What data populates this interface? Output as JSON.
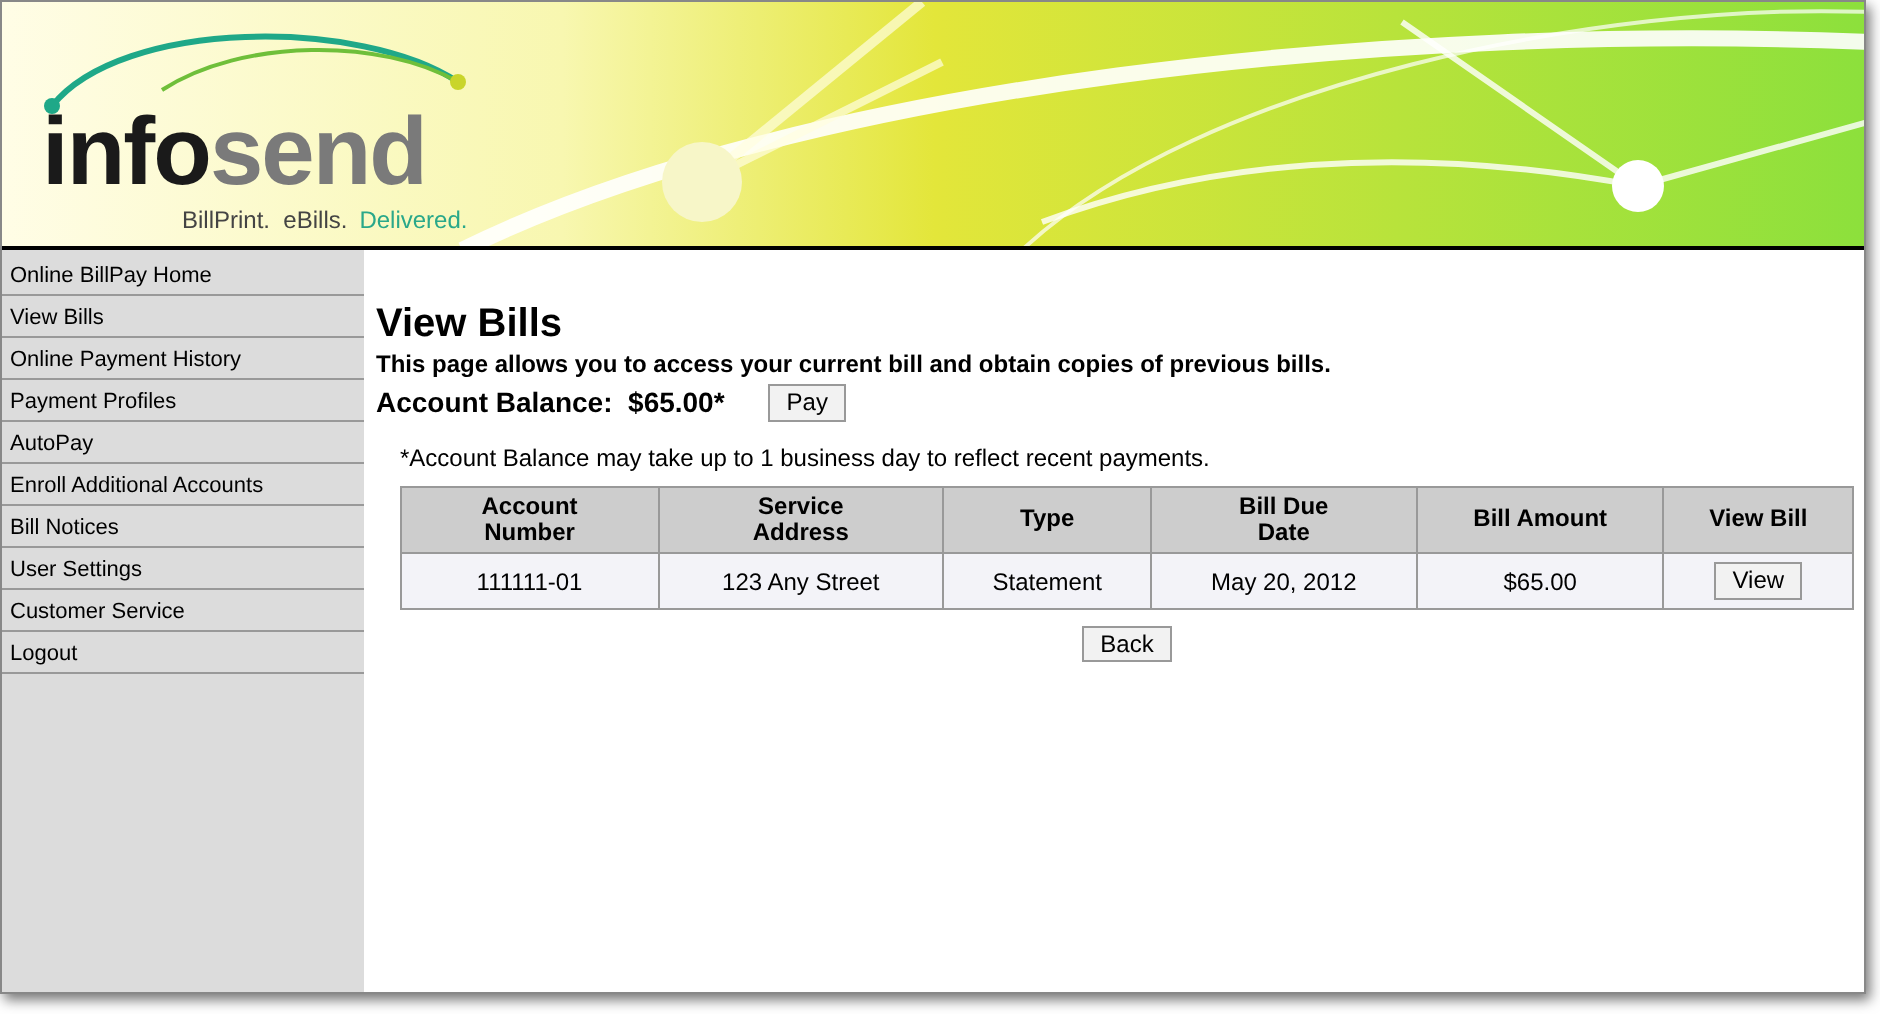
{
  "header": {
    "logo_parts": [
      "info",
      "send"
    ],
    "tagline": "BillPrint.  eBills.",
    "tagline_accent": "Delivered."
  },
  "sidebar": {
    "items": [
      "Online BillPay Home",
      "View Bills",
      "Online Payment History",
      "Payment Profiles",
      "AutoPay",
      "Enroll Additional Accounts",
      "Bill Notices",
      "User Settings",
      "Customer Service",
      "Logout"
    ]
  },
  "page": {
    "title": "View Bills",
    "description": "This page allows you to access your current bill and obtain copies of previous bills.",
    "balance_label": "Account Balance:",
    "balance_value": "$65.00*",
    "pay_button": "Pay",
    "note": "*Account Balance may take up to 1 business day to reflect recent payments."
  },
  "table": {
    "columns": [
      "Account Number",
      "Service Address",
      "Type",
      "Bill Due Date",
      "Bill Amount",
      "View Bill"
    ],
    "rows": [
      {
        "cells": [
          "111111-01",
          "123 Any Street",
          "Statement",
          "May 20, 2012",
          "$65.00"
        ],
        "button": "View"
      }
    ]
  },
  "back_button": "Back"
}
